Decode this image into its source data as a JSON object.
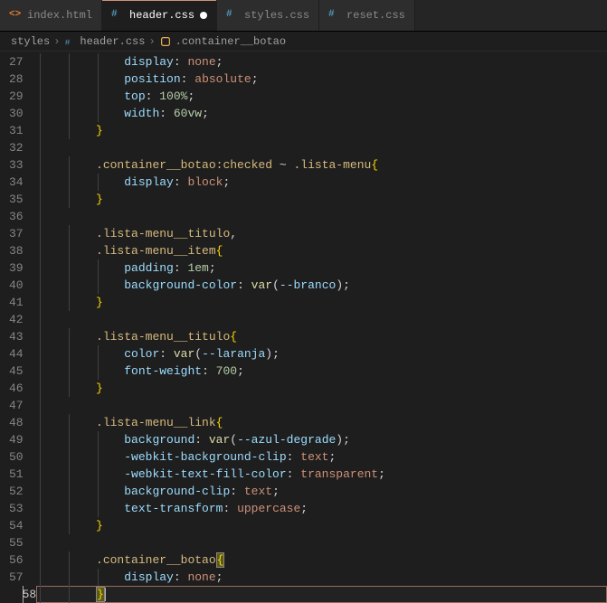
{
  "tabs": [
    {
      "label": "index.html",
      "type": "html",
      "active": false,
      "modified": false
    },
    {
      "label": "header.css",
      "type": "css",
      "active": true,
      "modified": true
    },
    {
      "label": "styles.css",
      "type": "css",
      "active": false,
      "modified": false
    },
    {
      "label": "reset.css",
      "type": "css",
      "active": false,
      "modified": false
    }
  ],
  "breadcrumb": {
    "folder": "styles",
    "file": "header.css",
    "symbol": ".container__botao"
  },
  "visible_range": {
    "start": 27,
    "end": 58
  },
  "cursor_line": 58,
  "code_lines": [
    {
      "n": 27,
      "indent": 3,
      "tokens": [
        [
          "prop",
          "display"
        ],
        [
          "punc",
          ": "
        ],
        [
          "val",
          "none"
        ],
        [
          "punc",
          ";"
        ]
      ]
    },
    {
      "n": 28,
      "indent": 3,
      "tokens": [
        [
          "prop",
          "position"
        ],
        [
          "punc",
          ": "
        ],
        [
          "val",
          "absolute"
        ],
        [
          "punc",
          ";"
        ]
      ]
    },
    {
      "n": 29,
      "indent": 3,
      "tokens": [
        [
          "prop",
          "top"
        ],
        [
          "punc",
          ": "
        ],
        [
          "num",
          "100%"
        ],
        [
          "punc",
          ";"
        ]
      ]
    },
    {
      "n": 30,
      "indent": 3,
      "tokens": [
        [
          "prop",
          "width"
        ],
        [
          "punc",
          ": "
        ],
        [
          "num",
          "60vw"
        ],
        [
          "punc",
          ";"
        ]
      ]
    },
    {
      "n": 31,
      "indent": 2,
      "tokens": [
        [
          "brace",
          "}"
        ]
      ]
    },
    {
      "n": 32,
      "indent": 1,
      "tokens": []
    },
    {
      "n": 33,
      "indent": 2,
      "tokens": [
        [
          "sel",
          ".container__botao:checked"
        ],
        [
          "punc",
          " ~ "
        ],
        [
          "sel",
          ".lista-menu"
        ],
        [
          "brace",
          "{"
        ]
      ]
    },
    {
      "n": 34,
      "indent": 3,
      "tokens": [
        [
          "prop",
          "display"
        ],
        [
          "punc",
          ": "
        ],
        [
          "val",
          "block"
        ],
        [
          "punc",
          ";"
        ]
      ]
    },
    {
      "n": 35,
      "indent": 2,
      "tokens": [
        [
          "brace",
          "}"
        ]
      ]
    },
    {
      "n": 36,
      "indent": 1,
      "tokens": []
    },
    {
      "n": 37,
      "indent": 2,
      "tokens": [
        [
          "sel",
          ".lista-menu__titulo"
        ],
        [
          "punc",
          ","
        ]
      ]
    },
    {
      "n": 38,
      "indent": 2,
      "tokens": [
        [
          "sel",
          ".lista-menu__item"
        ],
        [
          "brace",
          "{"
        ]
      ]
    },
    {
      "n": 39,
      "indent": 3,
      "tokens": [
        [
          "prop",
          "padding"
        ],
        [
          "punc",
          ": "
        ],
        [
          "num",
          "1em"
        ],
        [
          "punc",
          ";"
        ]
      ]
    },
    {
      "n": 40,
      "indent": 3,
      "tokens": [
        [
          "prop",
          "background-color"
        ],
        [
          "punc",
          ": "
        ],
        [
          "fn",
          "var"
        ],
        [
          "punc",
          "("
        ],
        [
          "var",
          "--branco"
        ],
        [
          "punc",
          ")"
        ],
        [
          "punc",
          ";"
        ]
      ]
    },
    {
      "n": 41,
      "indent": 2,
      "tokens": [
        [
          "brace",
          "}"
        ]
      ]
    },
    {
      "n": 42,
      "indent": 1,
      "tokens": []
    },
    {
      "n": 43,
      "indent": 2,
      "tokens": [
        [
          "sel",
          ".lista-menu__titulo"
        ],
        [
          "brace",
          "{"
        ]
      ]
    },
    {
      "n": 44,
      "indent": 3,
      "tokens": [
        [
          "prop",
          "color"
        ],
        [
          "punc",
          ": "
        ],
        [
          "fn",
          "var"
        ],
        [
          "punc",
          "("
        ],
        [
          "var",
          "--laranja"
        ],
        [
          "punc",
          ")"
        ],
        [
          "punc",
          ";"
        ]
      ]
    },
    {
      "n": 45,
      "indent": 3,
      "tokens": [
        [
          "prop",
          "font-weight"
        ],
        [
          "punc",
          ": "
        ],
        [
          "num",
          "700"
        ],
        [
          "punc",
          ";"
        ]
      ]
    },
    {
      "n": 46,
      "indent": 2,
      "tokens": [
        [
          "brace",
          "}"
        ]
      ]
    },
    {
      "n": 47,
      "indent": 1,
      "tokens": []
    },
    {
      "n": 48,
      "indent": 2,
      "tokens": [
        [
          "sel",
          ".lista-menu__link"
        ],
        [
          "brace",
          "{"
        ]
      ]
    },
    {
      "n": 49,
      "indent": 3,
      "tokens": [
        [
          "prop",
          "background"
        ],
        [
          "punc",
          ": "
        ],
        [
          "fn",
          "var"
        ],
        [
          "punc",
          "("
        ],
        [
          "var",
          "--azul-degrade"
        ],
        [
          "punc",
          ")"
        ],
        [
          "punc",
          ";"
        ]
      ]
    },
    {
      "n": 50,
      "indent": 3,
      "tokens": [
        [
          "prop",
          "-webkit-background-clip"
        ],
        [
          "punc",
          ": "
        ],
        [
          "val",
          "text"
        ],
        [
          "punc",
          ";"
        ]
      ]
    },
    {
      "n": 51,
      "indent": 3,
      "tokens": [
        [
          "prop",
          "-webkit-text-fill-color"
        ],
        [
          "punc",
          ": "
        ],
        [
          "val",
          "transparent"
        ],
        [
          "punc",
          ";"
        ]
      ]
    },
    {
      "n": 52,
      "indent": 3,
      "tokens": [
        [
          "prop",
          "background-clip"
        ],
        [
          "punc",
          ": "
        ],
        [
          "val",
          "text"
        ],
        [
          "punc",
          ";"
        ]
      ]
    },
    {
      "n": 53,
      "indent": 3,
      "tokens": [
        [
          "prop",
          "text-transform"
        ],
        [
          "punc",
          ": "
        ],
        [
          "val",
          "uppercase"
        ],
        [
          "punc",
          ";"
        ]
      ]
    },
    {
      "n": 54,
      "indent": 2,
      "tokens": [
        [
          "brace",
          "}"
        ]
      ]
    },
    {
      "n": 55,
      "indent": 1,
      "tokens": []
    },
    {
      "n": 56,
      "indent": 2,
      "tokens": [
        [
          "sel",
          ".container__botao"
        ],
        [
          "brace-hl",
          "{"
        ]
      ]
    },
    {
      "n": 57,
      "indent": 3,
      "tokens": [
        [
          "prop",
          "display"
        ],
        [
          "punc",
          ": "
        ],
        [
          "val",
          "none"
        ],
        [
          "punc",
          ";"
        ]
      ]
    },
    {
      "n": 58,
      "indent": 2,
      "tokens": [
        [
          "brace-hl",
          "}"
        ]
      ],
      "cursor": true
    }
  ]
}
